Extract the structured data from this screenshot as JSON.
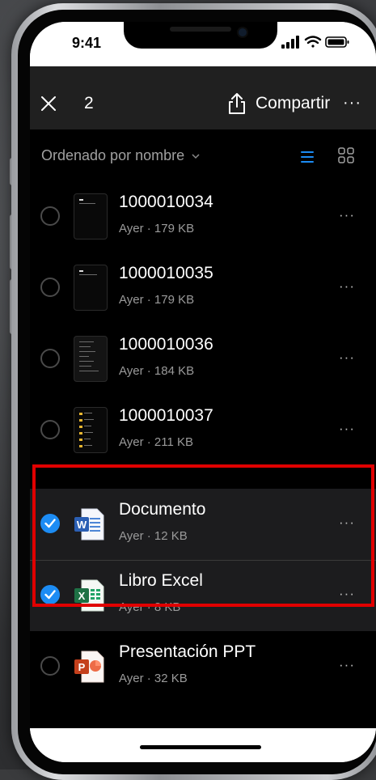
{
  "status_bar": {
    "time": "9:41"
  },
  "toolbar": {
    "selected_count": "2",
    "share_label": "Compartir",
    "more": "···"
  },
  "sort": {
    "label": "Ordenado por nombre"
  },
  "files": [
    {
      "name": "1000010034",
      "meta": "Ayer · 179 KB",
      "selected": false,
      "more": "···"
    },
    {
      "name": "1000010035",
      "meta": "Ayer · 179 KB",
      "selected": false,
      "more": "···"
    },
    {
      "name": "1000010036",
      "meta": "Ayer · 184 KB",
      "selected": false,
      "more": "···"
    },
    {
      "name": "1000010037",
      "meta": "Ayer · 211 KB",
      "selected": false,
      "more": "···"
    },
    {
      "name": "Documento",
      "meta": "Ayer · 12 KB",
      "selected": true,
      "icon": "word-icon",
      "more": "···"
    },
    {
      "name": "Libro Excel",
      "meta": "Ayer · 8 KB",
      "selected": true,
      "icon": "excel-icon",
      "more": "···"
    },
    {
      "name": "Presentación PPT",
      "meta": "Ayer · 32 KB",
      "selected": false,
      "icon": "powerpoint-icon",
      "more": "···"
    }
  ],
  "colors": {
    "accent": "#1c8cf4",
    "highlight": "#e00000",
    "word": "#2b5fb4",
    "excel": "#1e7145",
    "powerpoint": "#c4401c"
  }
}
